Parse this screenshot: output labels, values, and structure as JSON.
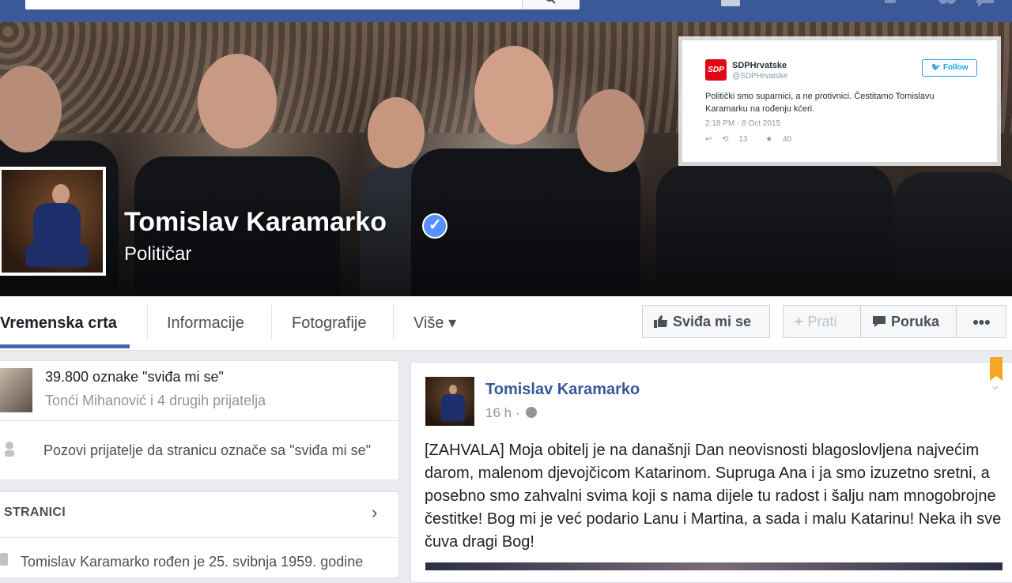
{
  "page": {
    "name": "Tomislav Karamarko",
    "category": "Političar"
  },
  "tweet": {
    "logo_text": "SDP",
    "name": "SDPHrvatske",
    "handle": "@SDPHrvatske",
    "follow_label": "Follow",
    "text": "Politički smo suparnici, a ne protivnici. Čestitamo Tomislavu Karamarku na rođenju kćeri.",
    "time": "2:18 PM - 8 Oct 2015",
    "retweets": "13",
    "favorites": "40"
  },
  "nav": {
    "tabs": [
      {
        "label": "Vremenska crta"
      },
      {
        "label": "Informacije"
      },
      {
        "label": "Fotografije"
      },
      {
        "label": "Više ▾"
      }
    ],
    "like_button": "Sviđa mi se",
    "follow_button": "Prati",
    "message_button": "Poruka",
    "more_button": "●●●"
  },
  "sidebar": {
    "likes_count": "39.800 oznake \"sviđa mi se\"",
    "likes_friends": "Tonći Mihanović i 4 drugih prijatelja",
    "invite_text": "Pozovi prijatelje da stranicu označe sa \"sviđa mi se\"",
    "about_header": "STRANICI",
    "about_text": "Tomislav Karamarko rođen je 25. svibnja 1959. godine"
  },
  "post": {
    "author": "Tomislav Karamarko",
    "time": "16 h ·",
    "text": "[ZAHVALA] Moja obitelj je na današnji Dan neovisnosti blagoslovljena najvećim darom, malenom djevojčicom Katarinom. Supruga Ana i ja smo izuzetno sretni, a posebno smo zahvalni svima koji s nama dijele tu radost i šalju nam mnogobrojne čestitke! Bog mi je već podario Lanu i Martina, a sada i malu Katarinu! Neka ih sve čuva dragi Bog!"
  },
  "colors": {
    "brand": "#3b5998",
    "link": "#365899",
    "twitter": "#1da1f2",
    "sdp_red": "#e30613"
  }
}
